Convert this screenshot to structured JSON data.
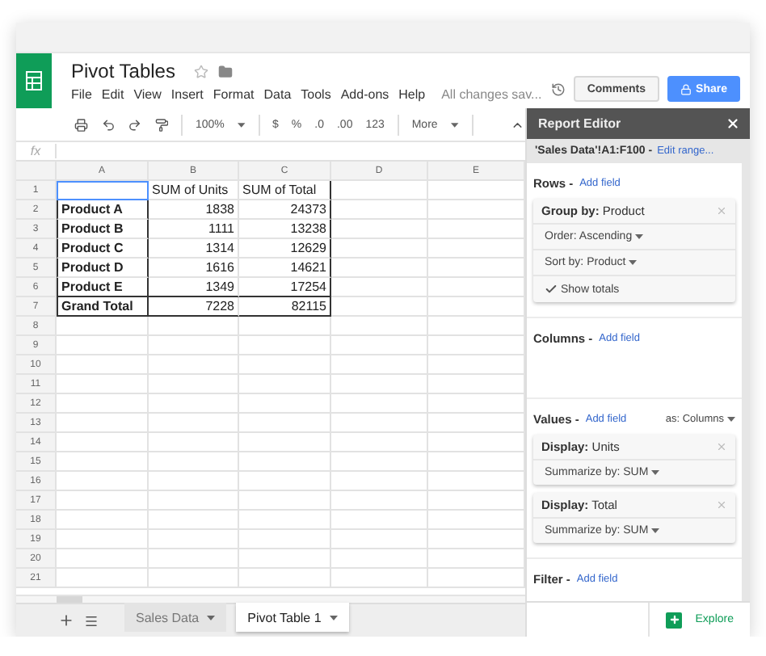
{
  "app": {
    "title": "Pivot Tables",
    "menu": [
      "File",
      "Edit",
      "View",
      "Insert",
      "Format",
      "Data",
      "Tools",
      "Add-ons",
      "Help"
    ],
    "save_status": "All changes sav...",
    "comments": "Comments",
    "share": "Share"
  },
  "toolbar": {
    "zoom": "100%",
    "formats": [
      "$",
      "%",
      ".0",
      ".00"
    ],
    "number_format": "123",
    "more": "More"
  },
  "formula_bar": {
    "label": "fx"
  },
  "sheet": {
    "columns": [
      "A",
      "B",
      "C",
      "D",
      "E"
    ],
    "row_numbers": [
      "1",
      "2",
      "3",
      "4",
      "5",
      "6",
      "7",
      "8",
      "9",
      "10",
      "11",
      "12",
      "13",
      "14",
      "15",
      "16",
      "17",
      "18",
      "19",
      "20",
      "21"
    ],
    "headers": [
      "SUM of Units",
      "SUM of Total"
    ],
    "rows": [
      {
        "label": "Product A",
        "values": [
          "1838",
          "24373"
        ]
      },
      {
        "label": "Product B",
        "values": [
          "1111",
          "13238"
        ]
      },
      {
        "label": "Product C",
        "values": [
          "1314",
          "12629"
        ]
      },
      {
        "label": "Product D",
        "values": [
          "1616",
          "14621"
        ]
      },
      {
        "label": "Product E",
        "values": [
          "1349",
          "17254"
        ]
      }
    ],
    "total": {
      "label": "Grand Total",
      "values": [
        "7228",
        "82115"
      ]
    }
  },
  "sheet_tabs": [
    {
      "label": "Sales Data",
      "selected": false
    },
    {
      "label": "Pivot Table 1",
      "selected": true
    }
  ],
  "report_editor": {
    "title": "Report Editor",
    "range": "'Sales Data'!A1:F100 -",
    "edit_range": "Edit range...",
    "sections": [
      {
        "label": "Rows -",
        "add": "Add field",
        "cards": [
          {
            "title": "**Group by:** Product",
            "options": [
              {
                "kind": "dropdown",
                "label": "Order: Ascending"
              },
              {
                "kind": "dropdown",
                "label": "Sort by: Product"
              },
              {
                "kind": "checkbox",
                "label": "Show totals",
                "checked": true
              }
            ]
          }
        ]
      },
      {
        "label": "Columns -",
        "add": "Add field"
      },
      {
        "label": "Values -",
        "add": "Add field",
        "extra": "as: Columns",
        "cards": [
          {
            "title": "**Display:** Units",
            "options": [
              {
                "kind": "dropdown",
                "label": "Summarize by: SUM"
              }
            ]
          },
          {
            "title": "**Display:** Total",
            "options": [
              {
                "kind": "dropdown",
                "label": "Summarize by: SUM"
              }
            ]
          }
        ]
      },
      {
        "label": "Filter -",
        "add": "Add field"
      }
    ],
    "explore": "Explore"
  }
}
